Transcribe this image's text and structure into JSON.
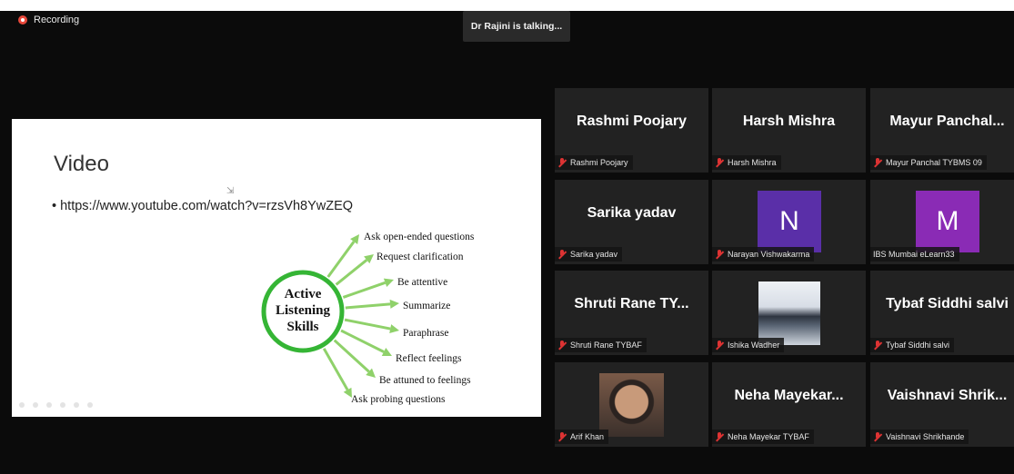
{
  "recording": {
    "label": "Recording"
  },
  "talking": {
    "label": "Dr Rajini is talking..."
  },
  "slide": {
    "title": "Video",
    "bullet": "• https://www.youtube.com/watch?v=rzsVh8YwZEQ",
    "center": [
      "Active",
      "Listening",
      "Skills"
    ],
    "skills": [
      "Ask open-ended questions",
      "Request clarification",
      "Be attentive",
      "Summarize",
      "Paraphrase",
      "Reflect feelings",
      "Be attuned to feelings",
      "Ask probing questions"
    ],
    "arrow_color": "#8fd16a",
    "ring_color": "#35b535"
  },
  "participants": [
    {
      "display": "Rashmi Poojary",
      "label": "Rashmi Poojary",
      "type": "name"
    },
    {
      "display": "Harsh Mishra",
      "label": "Harsh Mishra",
      "type": "name"
    },
    {
      "display": "Mayur  Panchal...",
      "label": "Mayur Panchal TYBMS 09",
      "type": "name"
    },
    {
      "display": "Sarika yadav",
      "label": "Sarika yadav",
      "type": "name"
    },
    {
      "display": "N",
      "label": "Narayan Vishwakarma",
      "type": "avatar",
      "color": "#5a2fa8"
    },
    {
      "display": "M",
      "label": "IBS Mumbai eLearn33",
      "type": "avatar",
      "color": "#8a2bb5"
    },
    {
      "display": "Shruti  Rane  TY...",
      "label": "Shruti Rane TYBAF",
      "type": "name"
    },
    {
      "display": "",
      "label": "Ishika Wadher",
      "type": "photo"
    },
    {
      "display": "Tybaf Siddhi salvi",
      "label": "Tybaf Siddhi salvi",
      "type": "name"
    },
    {
      "display": "",
      "label": "Arif Khan",
      "type": "photo"
    },
    {
      "display": "Neha  Mayekar...",
      "label": "Neha Mayekar TYBAF",
      "type": "name"
    },
    {
      "display": "Vaishnavi  Shrik...",
      "label": "Vaishnavi Shrikhande",
      "type": "name"
    }
  ]
}
